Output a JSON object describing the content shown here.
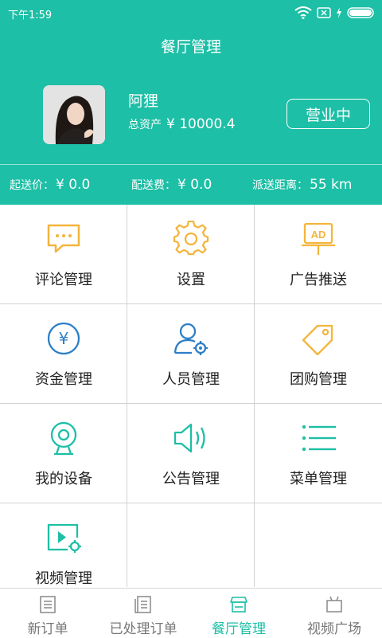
{
  "status_bar": {
    "time": "下午1:59"
  },
  "header": {
    "title": "餐厅管理",
    "user_name": "阿狸",
    "assets_label": "总资产",
    "assets_value": "¥ 10000.4",
    "status_button": "营业中"
  },
  "info_bar": {
    "min_order_label": "起送价：",
    "min_order_value": "¥ 0.0",
    "delivery_fee_label": "配送费：",
    "delivery_fee_value": "¥ 0.0",
    "distance_label": "派送距离：",
    "distance_value": "55 km"
  },
  "menu": [
    {
      "label": "评论管理",
      "icon": "comment-icon"
    },
    {
      "label": "设置",
      "icon": "gear-icon"
    },
    {
      "label": "广告推送",
      "icon": "ad-icon"
    },
    {
      "label": "资金管理",
      "icon": "yen-icon"
    },
    {
      "label": "人员管理",
      "icon": "staff-icon"
    },
    {
      "label": "团购管理",
      "icon": "tag-icon"
    },
    {
      "label": "我的设备",
      "icon": "webcam-icon"
    },
    {
      "label": "公告管理",
      "icon": "speaker-icon"
    },
    {
      "label": "菜单管理",
      "icon": "list-icon"
    },
    {
      "label": "视频管理",
      "icon": "video-icon"
    }
  ],
  "tabs": [
    {
      "label": "新订单"
    },
    {
      "label": "已处理订单"
    },
    {
      "label": "餐厅管理",
      "active": true
    },
    {
      "label": "视频广场"
    }
  ],
  "colors": {
    "accent": "#1dbfa6",
    "icon_yellow": "#f3b53c",
    "icon_blue": "#2d7fc6",
    "icon_teal": "#1dbfa6"
  }
}
